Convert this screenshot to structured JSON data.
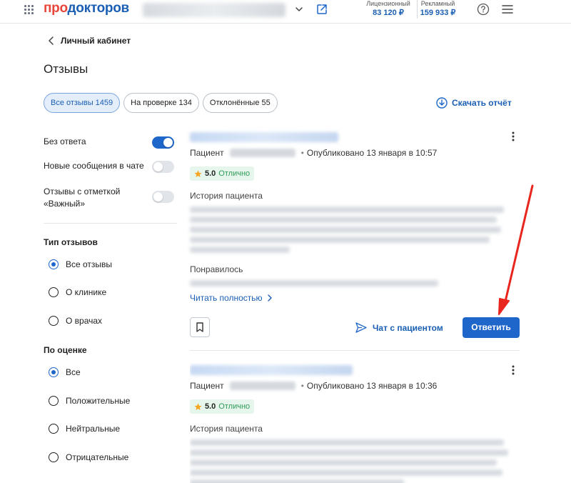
{
  "header": {
    "logo_part1": "про",
    "logo_part2": "докторов",
    "balances": [
      {
        "label": "Лицензионный",
        "value": "83 120 ₽"
      },
      {
        "label": "Рекламный",
        "value": "159 933 ₽"
      }
    ],
    "icons": [
      "apps-grid-icon",
      "chevron-down-icon",
      "external-link-icon",
      "help-icon",
      "menu-icon"
    ]
  },
  "breadcrumb": {
    "back_label": "Личный кабинет"
  },
  "page": {
    "title": "Отзывы"
  },
  "filter_tabs": [
    {
      "label": "Все отзывы 1459",
      "active": true
    },
    {
      "label": "На проверке 134",
      "active": false
    },
    {
      "label": "Отклонённые 55",
      "active": false
    }
  ],
  "download_report": {
    "label": "Скачать отчёт"
  },
  "sidebar": {
    "toggles": [
      {
        "label": "Без ответа",
        "on": true
      },
      {
        "label": "Новые сообщения в чате",
        "on": false
      },
      {
        "label": "Отзывы с отметкой «Важный»",
        "on": false
      }
    ],
    "review_type": {
      "title": "Тип отзывов",
      "options": [
        {
          "label": "Все отзывы",
          "checked": true
        },
        {
          "label": "О клинике",
          "checked": false
        },
        {
          "label": "О врачах",
          "checked": false
        }
      ]
    },
    "rating_filter": {
      "title": "По оценке",
      "options": [
        {
          "label": "Все",
          "checked": true
        },
        {
          "label": "Положительные",
          "checked": false
        },
        {
          "label": "Нейтральные",
          "checked": false
        },
        {
          "label": "Отрицательные",
          "checked": false
        }
      ]
    }
  },
  "reviews": [
    {
      "patient_label": "Пациент",
      "published": "Опубликовано 13 января в 10:57",
      "rating": "5.0",
      "rating_word": "Отлично",
      "history_label": "История пациента",
      "liked_label": "Понравилось",
      "read_more": "Читать полностью",
      "chat_label": "Чат с пациентом",
      "reply_label": "Ответить"
    },
    {
      "patient_label": "Пациент",
      "published": "Опубликовано 13 января в 10:36",
      "rating": "5.0",
      "rating_word": "Отлично",
      "history_label": "История пациента"
    }
  ],
  "colors": {
    "brand_blue": "#1e66c9",
    "logo_red": "#e8463a",
    "rating_green": "#2f9b5a",
    "annotation_arrow": "#e8261e"
  }
}
